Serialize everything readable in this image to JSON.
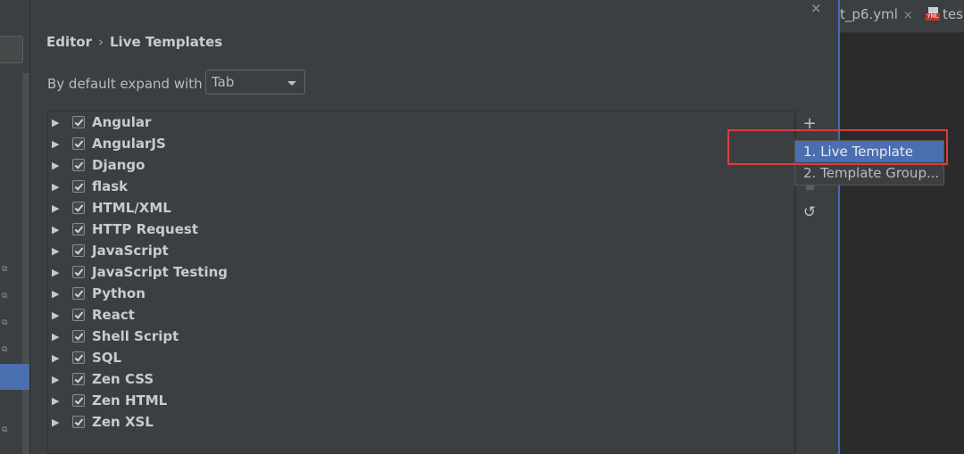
{
  "breadcrumb": {
    "parent": "Editor",
    "separator": "›",
    "current": "Live Templates"
  },
  "expand": {
    "label": "By default expand with",
    "value": "Tab"
  },
  "template_groups": [
    {
      "label": "Angular",
      "checked": true
    },
    {
      "label": "AngularJS",
      "checked": true
    },
    {
      "label": "Django",
      "checked": true
    },
    {
      "label": "flask",
      "checked": true
    },
    {
      "label": "HTML/XML",
      "checked": true
    },
    {
      "label": "HTTP Request",
      "checked": true
    },
    {
      "label": "JavaScript",
      "checked": true
    },
    {
      "label": "JavaScript Testing",
      "checked": true
    },
    {
      "label": "Python",
      "checked": true
    },
    {
      "label": "React",
      "checked": true
    },
    {
      "label": "Shell Script",
      "checked": true
    },
    {
      "label": "SQL",
      "checked": true
    },
    {
      "label": "Zen CSS",
      "checked": true
    },
    {
      "label": "Zen HTML",
      "checked": true
    },
    {
      "label": "Zen XSL",
      "checked": true
    }
  ],
  "toolbar": {
    "add": "+",
    "restore": "↺"
  },
  "popup": {
    "items": [
      "1. Live Template",
      "2. Template Group..."
    ]
  },
  "editor_tabs": [
    {
      "label": "t_p6.yml",
      "close": "×"
    },
    {
      "label": "tes"
    }
  ],
  "window": {
    "close": "×"
  },
  "icons": {
    "expand": "triangle-right-icon",
    "checkbox": "check-icon",
    "add": "plus-icon",
    "restore": "undo-icon",
    "yml": "yml-file-icon"
  }
}
